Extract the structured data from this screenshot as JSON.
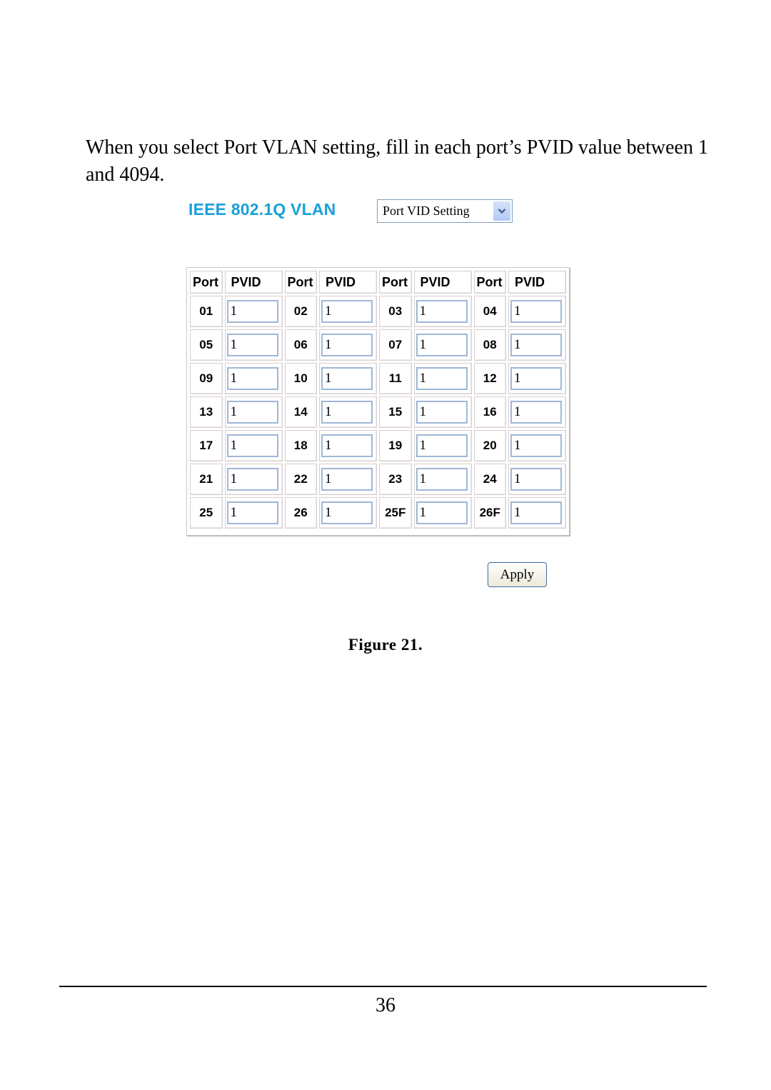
{
  "intro_text": "When you select Port VLAN setting, fill in each port’s PVID value between 1 and 4094.",
  "panel": {
    "title": "IEEE 802.1Q VLAN",
    "mode_select": {
      "value": "Port VID Setting",
      "icon": "chevron-down-icon"
    },
    "headers": {
      "port": "Port",
      "pvid": "PVID"
    },
    "rows": [
      [
        {
          "port": "01",
          "pvid": "1"
        },
        {
          "port": "02",
          "pvid": "1"
        },
        {
          "port": "03",
          "pvid": "1"
        },
        {
          "port": "04",
          "pvid": "1"
        }
      ],
      [
        {
          "port": "05",
          "pvid": "1"
        },
        {
          "port": "06",
          "pvid": "1"
        },
        {
          "port": "07",
          "pvid": "1"
        },
        {
          "port": "08",
          "pvid": "1"
        }
      ],
      [
        {
          "port": "09",
          "pvid": "1"
        },
        {
          "port": "10",
          "pvid": "1"
        },
        {
          "port": "11",
          "pvid": "1"
        },
        {
          "port": "12",
          "pvid": "1"
        }
      ],
      [
        {
          "port": "13",
          "pvid": "1"
        },
        {
          "port": "14",
          "pvid": "1"
        },
        {
          "port": "15",
          "pvid": "1"
        },
        {
          "port": "16",
          "pvid": "1"
        }
      ],
      [
        {
          "port": "17",
          "pvid": "1"
        },
        {
          "port": "18",
          "pvid": "1"
        },
        {
          "port": "19",
          "pvid": "1"
        },
        {
          "port": "20",
          "pvid": "1"
        }
      ],
      [
        {
          "port": "21",
          "pvid": "1"
        },
        {
          "port": "22",
          "pvid": "1"
        },
        {
          "port": "23",
          "pvid": "1"
        },
        {
          "port": "24",
          "pvid": "1"
        }
      ],
      [
        {
          "port": "25",
          "pvid": "1"
        },
        {
          "port": "26",
          "pvid": "1"
        },
        {
          "port": "25F",
          "pvid": "1"
        },
        {
          "port": "26F",
          "pvid": "1"
        }
      ]
    ],
    "apply_label": "Apply",
    "title_color": "#1aa0d8"
  },
  "caption": "Figure 21.",
  "page_number": "36"
}
